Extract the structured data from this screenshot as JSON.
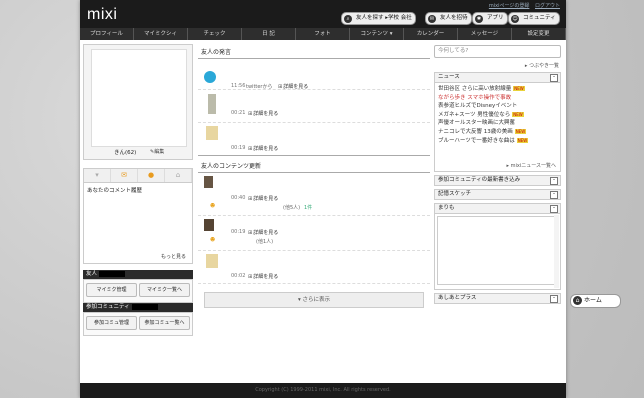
{
  "header": {
    "logo": "mixi",
    "top_links": [
      "mixiページの登録",
      "ログアウト"
    ],
    "buttons": [
      {
        "label": "友人を探す ▸学校 会社",
        "icon": "search-icon"
      },
      {
        "label": "友人を招待",
        "icon": "mail-icon"
      },
      {
        "label": "アプリ",
        "icon": "app-icon"
      },
      {
        "label": "コミュニティ",
        "icon": "community-icon"
      }
    ]
  },
  "nav": [
    "プロフィール",
    "マイミクシィ",
    "チェック",
    "日 記",
    "フォト",
    "コンテンツ ▾",
    "カレンダー",
    "メッセージ",
    "設定変更"
  ],
  "profile": {
    "name": "きん(62)",
    "edit": "編集"
  },
  "comment": {
    "title": "あなたのコメント履歴",
    "more": "もっと見る"
  },
  "friends": {
    "title": "友人",
    "btn1": "マイミク管理",
    "btn2": "マイミク一覧へ"
  },
  "community": {
    "title": "参加コミュニティ",
    "btn1": "参加コミュ管理",
    "btn2": "参加コミュ一覧へ"
  },
  "voices": {
    "title": "友人の発言",
    "items": [
      {
        "time": "11:56",
        "via": "twitterから",
        "link": "詳細を見る"
      },
      {
        "time": "00:21",
        "link": "詳細を見る"
      },
      {
        "time": "00:19",
        "link": "詳細を見る"
      }
    ]
  },
  "updates": {
    "title": "友人のコンテンツ更新",
    "items": [
      {
        "time": "00:40",
        "link": "詳細を見る",
        "stats": [
          "(他5人)",
          "1件"
        ]
      },
      {
        "time": "00:19",
        "link": "詳細を見る",
        "stats": [
          "(他1人)"
        ]
      },
      {
        "time": "00:02",
        "link": "詳細を見る"
      }
    ],
    "more": "さらに表示"
  },
  "search": {
    "placeholder": "今何してる?"
  },
  "tsubuyaki": "つぶやき一覧",
  "news": {
    "title": "ニュース",
    "items": [
      {
        "text": "世田谷区 さらに高い放射線量",
        "new": true,
        "hl": false
      },
      {
        "text": "ながら歩き スマホ操作で事故",
        "new": false,
        "hl": true
      },
      {
        "text": "表参道ヒルズでDisneyイベント",
        "new": false,
        "hl": false
      },
      {
        "text": "メガネ+スーツ 男性優位なら",
        "new": true,
        "hl": false
      },
      {
        "text": "声優オールスター映画に大興奮",
        "new": false,
        "hl": false
      },
      {
        "text": "ナニコレで大反響 13歳の美画",
        "new": true,
        "hl": false
      },
      {
        "text": "ブルーハーツで一番好きな曲は",
        "new": true,
        "hl": false
      }
    ],
    "new_label": "NEW",
    "all": "mixiニュース一覧へ"
  },
  "right_boxes": [
    "参加コミュニティの最新書き込み",
    "記憶スケッチ",
    "まりも",
    "あしあとプラス"
  ],
  "footer": "Copyright (C) 1999-2011 mixi, Inc. All rights reserved.",
  "home": "ホーム"
}
